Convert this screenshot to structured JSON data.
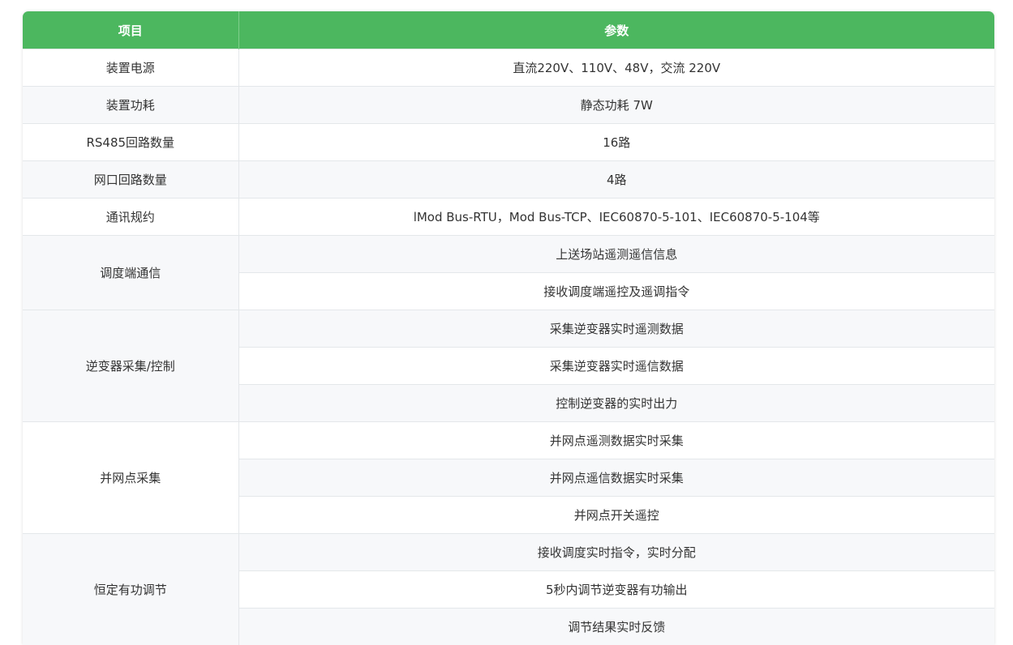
{
  "header": {
    "col_item": "项目",
    "col_param": "参数"
  },
  "rows": [
    {
      "item": "装置电源",
      "value": "直流220V、110V、48V，交流 220V"
    },
    {
      "item": "装置功耗",
      "value": "静态功耗 7W"
    },
    {
      "item": "RS485回路数量",
      "value": "16路"
    },
    {
      "item": "网口回路数量",
      "value": "4路"
    },
    {
      "item": "通讯规约",
      "value": "lMod Bus-RTU，Mod Bus-TCP、IEC60870-5-101、IEC60870-5-104等"
    }
  ],
  "groups": [
    {
      "item": "调度端通信",
      "values": [
        "上送场站遥测遥信信息",
        "接收调度端遥控及遥调指令"
      ]
    },
    {
      "item": "逆变器采集/控制",
      "values": [
        "采集逆变器实时遥测数据",
        "采集逆变器实时遥信数据",
        "控制逆变器的实时出力"
      ]
    },
    {
      "item": "并网点采集",
      "values": [
        "并网点遥测数据实时采集",
        "并网点遥信数据实时采集",
        "并网点开关遥控"
      ]
    },
    {
      "item": "恒定有功调节",
      "values": [
        "接收调度实时指令，实时分配",
        "5秒内调节逆变器有功输出",
        "调节结果实时反馈"
      ]
    }
  ],
  "colors": {
    "header_bg": "#4cb75f",
    "stripe": "#f7f8fa",
    "border": "#e4e7ea"
  }
}
